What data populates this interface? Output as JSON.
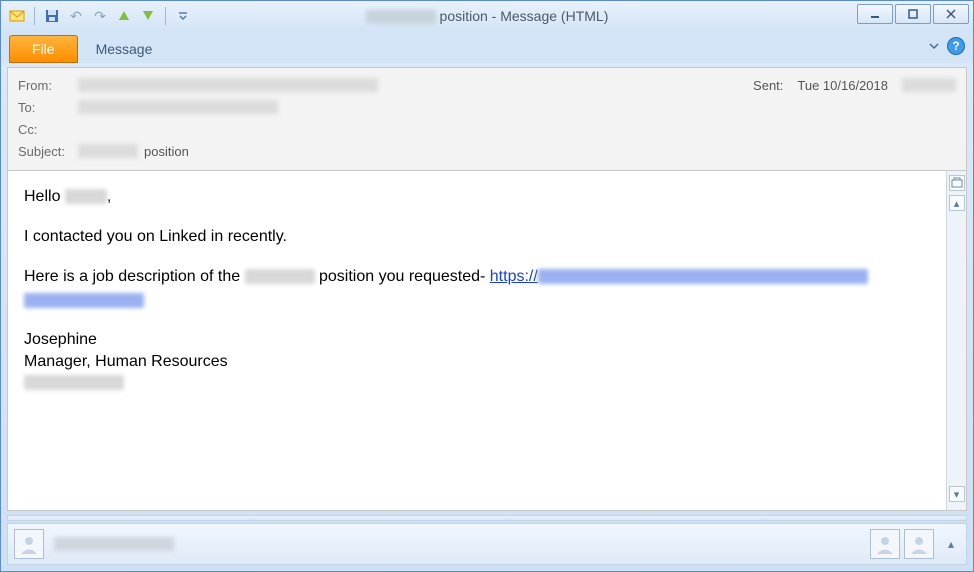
{
  "window": {
    "title_suffix": "position - Message (HTML)"
  },
  "qat": {
    "icons": [
      "mail-icon",
      "save-icon",
      "undo-icon",
      "redo-icon",
      "prev-icon",
      "next-icon",
      "customize-icon"
    ]
  },
  "ribbon": {
    "file_label": "File",
    "message_label": "Message"
  },
  "header": {
    "from_label": "From:",
    "to_label": "To:",
    "cc_label": "Cc:",
    "subject_label": "Subject:",
    "subject_value_suffix": "position",
    "sent_label": "Sent:",
    "sent_value": "Tue 10/16/2018"
  },
  "body": {
    "greeting_prefix": "Hello ",
    "greeting_suffix": ",",
    "line2": "I contacted you on Linked in recently.",
    "line3_a": "Here is a job description of the ",
    "line3_b": " position you requested- ",
    "link_prefix": "https://",
    "sig_name": "Josephine",
    "sig_title": "Manager, Human Resources"
  },
  "footer": {
    "expand_label": "▴"
  }
}
